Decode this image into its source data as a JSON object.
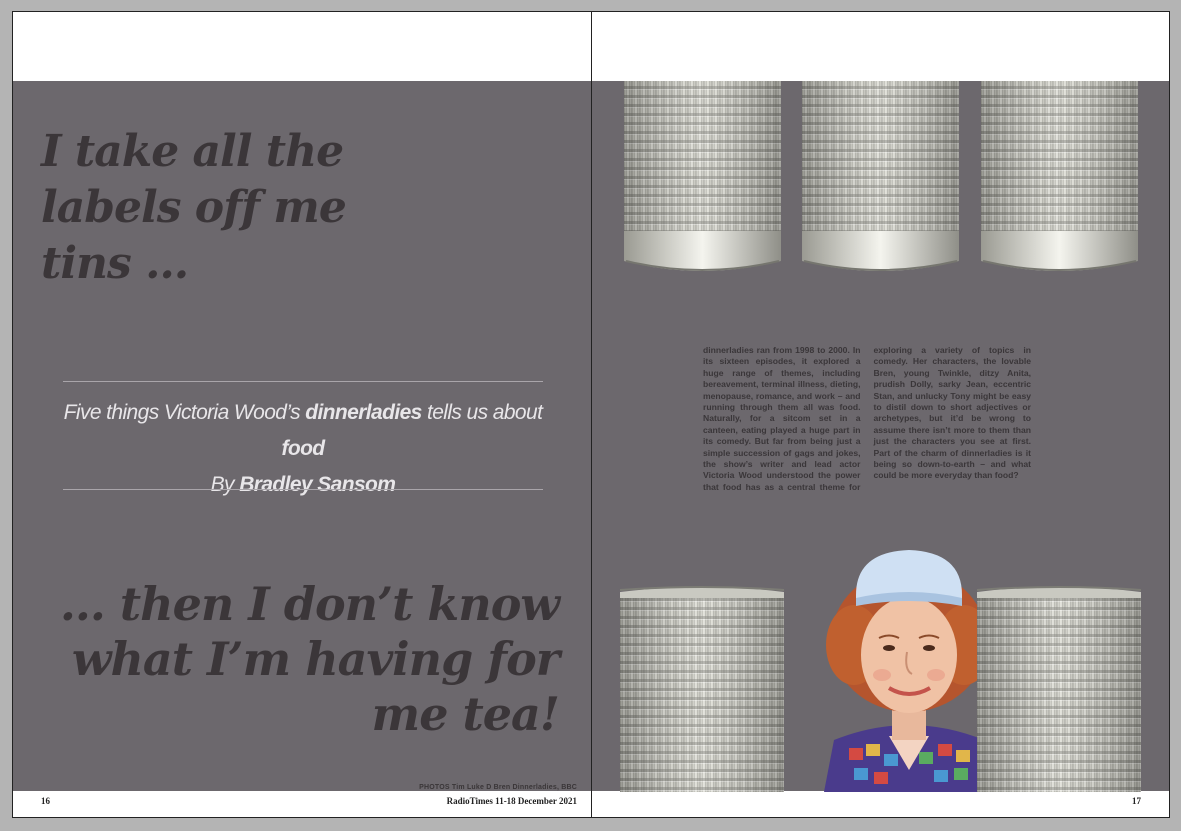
{
  "left_page": {
    "headline_top": "I take all the labels off me tins …",
    "standfirst_lead": "Five things Victoria Wood’s ",
    "standfirst_show": "dinnerladies",
    "standfirst_mid": " tells us about ",
    "standfirst_food": "food",
    "byline_prefix": "By ",
    "byline_author": "Bradley Sansom",
    "headline_bottom": "… then I don’t know what I’m having for me tea!",
    "photo_credit": "PHOTOS  Tim Luke D   Bren Dinnerladies, BBC",
    "folio": "16",
    "issue_line": "RadioTimes 11-18 December 2021"
  },
  "right_page": {
    "body": "dinnerladies ran from 1998 to 2000. In its sixteen episodes, it explored a huge range of themes, including bereavement, terminal illness, dieting, menopause, romance, and work – and running through them all was food. Naturally, for a sitcom set in a canteen, eating played a huge part in its comedy. But far from being just a simple succession of gags and jokes, the show’s writer and lead actor Victoria Wood understood the power that food has as a central theme for exploring a variety of topics in comedy. Her characters, the lovable Bren, young Twinkle, ditzy Anita, prudish Dolly, sarky Jean, eccentric Stan, and unlucky Tony might be easy to distil down to short adjectives or archetypes, but it’d be wrong to assume there isn’t more to them than just the characters you see at first. Part of the charm of dinnerladies is it being so down-to-earth – and what could be more everyday than food?",
    "folio": "17"
  },
  "colors": {
    "panel": "#6c686d",
    "headline": "#3b3639",
    "standfirst": "#e8e6e9",
    "paper": "#ffffff"
  },
  "images": {
    "cans": "tin-can-icon",
    "portrait": "dinner-lady-portrait"
  }
}
